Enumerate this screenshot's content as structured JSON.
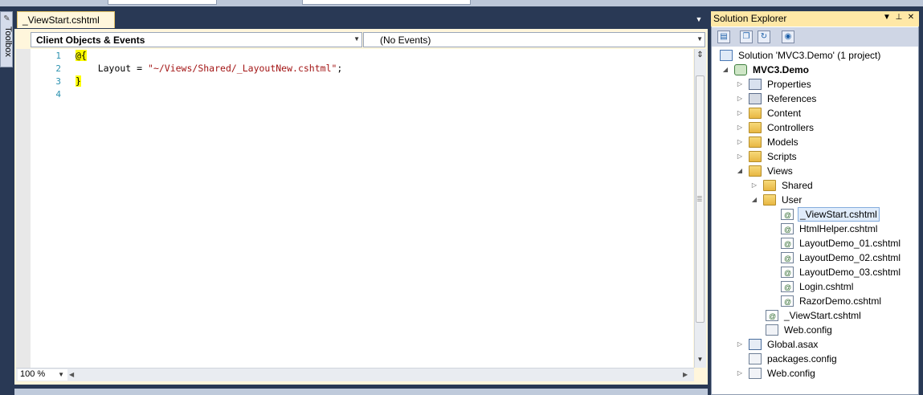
{
  "editor": {
    "tab_label": "_ViewStart.cshtml",
    "nav_left": "Client Objects & Events",
    "nav_right": "(No Events)",
    "line_numbers": [
      "1",
      "2",
      "3",
      "4"
    ],
    "code": {
      "line1": "@{",
      "line2_prefix": "    Layout = ",
      "line2_string": "\"~/Views/Shared/_LayoutNew.cshtml\"",
      "line2_suffix": ";",
      "line3": "}"
    },
    "zoom": "100 %"
  },
  "toolbox": {
    "label": "Toolbox"
  },
  "solution_explorer": {
    "title": "Solution Explorer",
    "solution": "Solution 'MVC3.Demo' (1 project)",
    "project": "MVC3.Demo",
    "items": {
      "properties": "Properties",
      "references": "References",
      "content": "Content",
      "controllers": "Controllers",
      "models": "Models",
      "scripts": "Scripts",
      "views": "Views",
      "shared": "Shared",
      "user": "User",
      "user_viewstart": "_ViewStart.cshtml",
      "htmlhelper": "HtmlHelper.cshtml",
      "layoutdemo01": "LayoutDemo_01.cshtml",
      "layoutdemo02": "LayoutDemo_02.cshtml",
      "layoutdemo03": "LayoutDemo_03.cshtml",
      "login": "Login.cshtml",
      "razordemo": "RazorDemo.cshtml",
      "views_viewstart": "_ViewStart.cshtml",
      "views_webconfig": "Web.config",
      "global_asax": "Global.asax",
      "packages_config": "packages.config",
      "webconfig": "Web.config"
    }
  }
}
